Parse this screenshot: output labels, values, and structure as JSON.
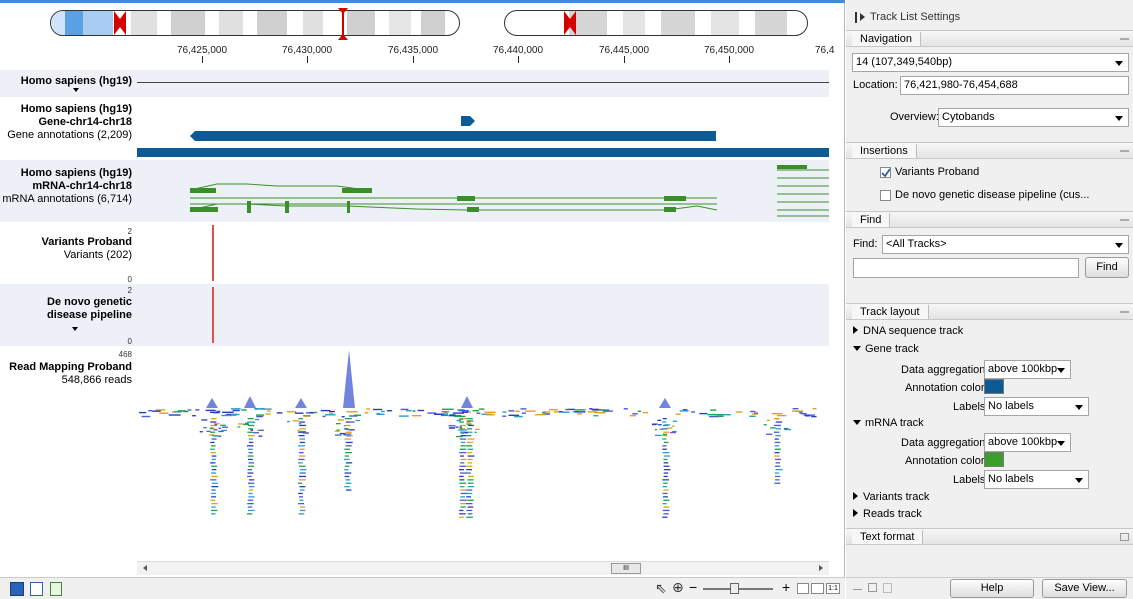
{
  "ruler": {
    "ticks": [
      "76,425,000",
      "76,430,000",
      "76,435,000",
      "76,440,000",
      "76,445,000",
      "76,450,000",
      "76,4"
    ]
  },
  "tracks": {
    "genome": {
      "name": "Homo sapiens (hg19)"
    },
    "gene": {
      "name": "Homo sapiens (hg19)",
      "sub": "Gene-chr14-chr18",
      "annot": "Gene annotations (2,209)"
    },
    "mrna": {
      "name": "Homo sapiens (hg19)",
      "sub": "mRNA-chr14-chr18",
      "annot": "mRNA annotations (6,714)"
    },
    "variants": {
      "max": "2",
      "name": "Variants Proband",
      "annot": "Variants (202)",
      "min": "0"
    },
    "denovo": {
      "max": "2",
      "name1": "De novo genetic",
      "name2": "disease pipeline",
      "min": "0"
    },
    "reads": {
      "max": "468",
      "name": "Read Mapping Proband",
      "annot": "548,866 reads"
    }
  },
  "colors": {
    "gene": "#0d5b94",
    "mrna": "#3b8f2a",
    "variant": "#d9534f",
    "track_shade": "#eef0f8",
    "accent": "#3c8fe0"
  },
  "scroll": {
    "thumb_glyph": "III"
  },
  "zoom": {
    "minus": "−",
    "plus": "+",
    "ratio": "1:1"
  },
  "panel": {
    "title": "Track List Settings",
    "navigation": {
      "header": "Navigation",
      "chromosome": "14 (107,349,540bp)",
      "location_label": "Location:",
      "location_value": "76,421,980-76,454,688",
      "overview_label": "Overview:",
      "overview_value": "Cytobands"
    },
    "insertions": {
      "header": "Insertions",
      "items": [
        {
          "label": "Variants Proband",
          "checked": true
        },
        {
          "label": "De novo genetic disease pipeline (cus...",
          "checked": false
        }
      ]
    },
    "find": {
      "header": "Find",
      "label": "Find:",
      "scope": "<All Tracks>",
      "query": "",
      "button": "Find"
    },
    "layout": {
      "header": "Track layout",
      "dna": "DNA sequence track",
      "gene": "Gene track",
      "mrna": "mRNA track",
      "variants": "Variants track",
      "reads": "Reads track",
      "data_agg_label": "Data aggregation",
      "data_agg_value": "above 100kbp",
      "annot_color_label": "Annotation color",
      "labels_label": "Labels",
      "labels_value": "No labels"
    },
    "text_format": {
      "header": "Text format"
    },
    "buttons": {
      "help": "Help",
      "save_view": "Save View..."
    }
  }
}
